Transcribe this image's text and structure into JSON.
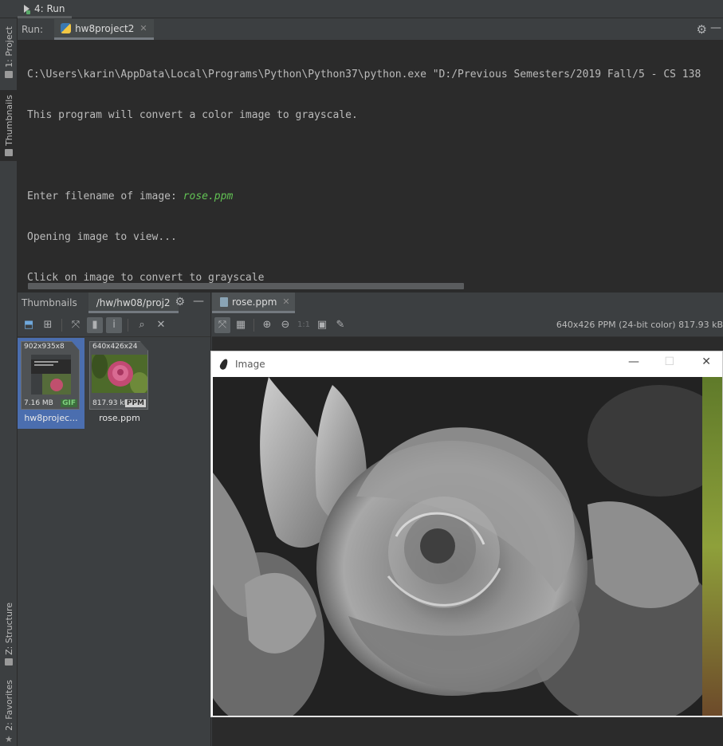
{
  "top_tab": {
    "label": "4: Run"
  },
  "left_strip": {
    "project": "1: Project",
    "thumbnails": "Thumbnails",
    "structure": "Z: Structure",
    "favorites": "2: Favorites"
  },
  "run": {
    "label": "Run:",
    "config": "hw8project2"
  },
  "console": {
    "lines": [
      "C:\\Users\\karin\\AppData\\Local\\Programs\\Python\\Python37\\python.exe \"D:/Previous Semesters/2019 Fall/5 - CS 138",
      "This program will convert a color image to grayscale.",
      "",
      "Enter filename of image: ",
      "Opening image to view...",
      "Click on image to convert to grayscale"
    ],
    "input_value": "rose.ppm"
  },
  "thumbnails": {
    "title": "Thumbnails",
    "path": "/hw/hw08/proj2",
    "items": [
      {
        "dim": "902x935x8",
        "size": "7.16 MB",
        "badge": "GIF",
        "name": "hw8projec..."
      },
      {
        "dim": "640x426x24",
        "size": "817.93 kB",
        "badge": "PPM",
        "name": "rose.ppm"
      }
    ]
  },
  "viewer": {
    "tab": "rose.ppm",
    "info": "640x426 PPM (24-bit color) 817.93 kB",
    "zoom_label": "1:1"
  },
  "tk_window": {
    "title": "Image"
  },
  "colors": {
    "console_bg": "#2b2b2b",
    "panel_bg": "#3c3f41",
    "input_green": "#62c254",
    "selection": "#4b6eaf"
  }
}
